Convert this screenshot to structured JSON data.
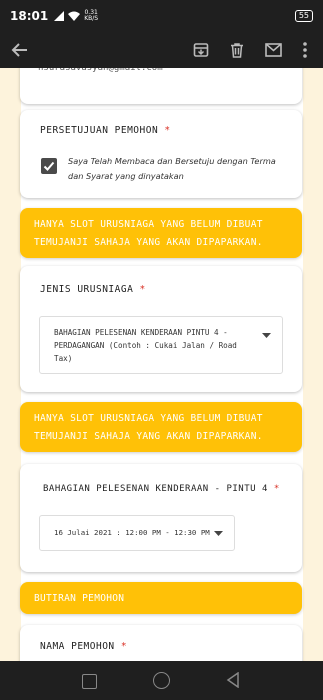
{
  "status": {
    "time": "18:01",
    "speed_value": "0.31",
    "speed_unit": "KB/S",
    "battery": "55"
  },
  "toolbar": {
    "back_icon": "arrow-back-icon",
    "archive_icon": "archive-icon",
    "delete_icon": "trash-icon",
    "mail_icon": "mail-icon",
    "more_icon": "more-vert-icon"
  },
  "email_partial": "nsurasavasyan@gmail.com",
  "consent": {
    "title": "PERSETUJUAN PEMOHON",
    "required_mark": "*",
    "checked": true,
    "line1": "Saya Telah Membaca dan Bersetuju dengan Terma",
    "line2": "dan Syarat yang dinyatakan"
  },
  "banner1": {
    "line1": "HANYA SLOT URUSNIAGA YANG BELUM DIBUAT",
    "line2": "TEMUJANJI SAHAJA YANG AKAN DIPAPARKAN."
  },
  "jenis": {
    "title": "JENIS URUSNIAGA",
    "required_mark": "*",
    "line1": "BAHAGIAN PELESENAN KENDERAAN PINTU 4 -",
    "line2": "PERDAGANGAN (Contoh : Cukai Jalan / Road",
    "line3": "Tax)"
  },
  "banner2": {
    "line1": "HANYA SLOT URUSNIAGA YANG BELUM DIBUAT",
    "line2": "TEMUJANJI SAHAJA YANG AKAN DIPAPARKAN."
  },
  "slot": {
    "title": "BAHAGIAN PELESENAN KENDERAAN - PINTU 4",
    "required_mark": "*",
    "value": "16 Julai 2021 : 12:00 PM - 12:30 PM"
  },
  "banner3": {
    "line1": "BUTIRAN PEMOHON"
  },
  "nama": {
    "title": "NAMA PEMOHON",
    "required_mark": "*"
  },
  "colors": {
    "accent": "#ffc107",
    "page_bg": "#fdf3dc",
    "required": "#d93025",
    "dark_bar": "#1f1f1f"
  }
}
